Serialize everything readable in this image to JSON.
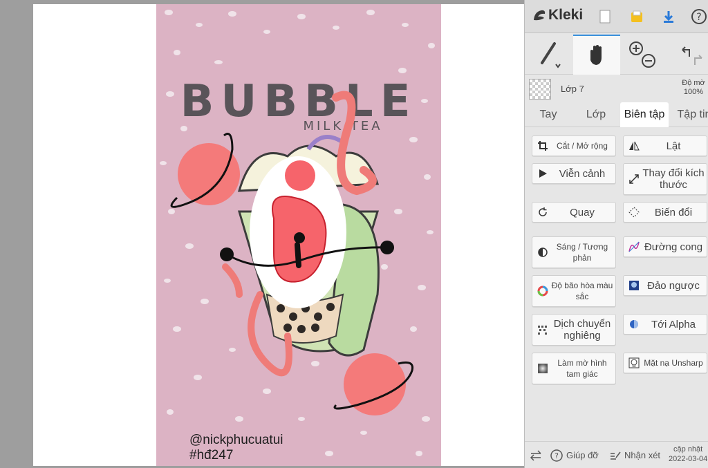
{
  "artwork": {
    "title": "BUBBLE",
    "subtitle": "MILK TEA",
    "credit_line1": "@nickphucuatui",
    "credit_line2": "#hđ247"
  },
  "app": {
    "name": "Kleki"
  },
  "layer": {
    "name": "Lớp 7",
    "opacity_label": "Độ mờ",
    "opacity_value": "100%"
  },
  "tabs": [
    {
      "label": "Tay"
    },
    {
      "label": "Lớp"
    },
    {
      "label": "Biên tập",
      "active": true
    },
    {
      "label": "Tập tin"
    }
  ],
  "edit_buttons": [
    {
      "label": "Cắt / Mở rộng",
      "icon": "crop-icon"
    },
    {
      "label": "Lật",
      "icon": "flip-icon"
    },
    {
      "label": "Viễn cảnh",
      "icon": "perspective-icon"
    },
    {
      "label": "Thay đổi kích thước",
      "icon": "resize-icon"
    },
    {
      "label": "Quay",
      "icon": "rotate-icon"
    },
    {
      "label": "Biến đổi",
      "icon": "transform-icon"
    },
    {
      "label": "Sáng / Tương phản",
      "icon": "brightness-contrast-icon"
    },
    {
      "label": "Đường cong",
      "icon": "curves-icon"
    },
    {
      "label": "Độ bão hòa màu sắc",
      "icon": "hue-saturation-icon"
    },
    {
      "label": "Đảo ngược",
      "icon": "invert-icon"
    },
    {
      "label": "Dịch chuyển nghiêng",
      "icon": "tilt-shift-icon"
    },
    {
      "label": "Tới Alpha",
      "icon": "to-alpha-icon"
    },
    {
      "label": "Làm mờ hình tam giác",
      "icon": "triangle-blur-icon"
    },
    {
      "label": "Mặt nạ Unsharp",
      "icon": "unsharp-mask-icon"
    }
  ],
  "bottom": {
    "help": "Giúp đỡ",
    "feedback": "Nhận xét",
    "update_label": "cập nhật",
    "update_date": "2022-03-04"
  },
  "colors": {
    "artwork_bg": "#dcb3c4",
    "accent_red": "#f47a7a",
    "panel_bg": "#e6e6e6",
    "active_tab_line": "#3a8fdc"
  }
}
